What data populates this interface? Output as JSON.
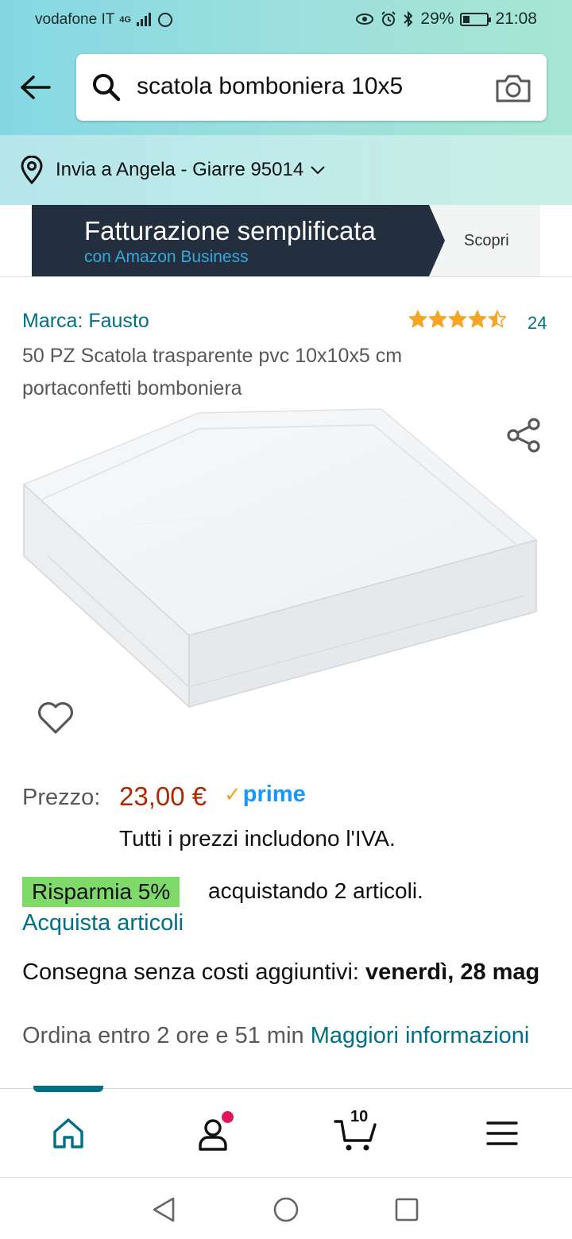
{
  "status_bar": {
    "carrier": "vodafone IT",
    "network": "4G",
    "battery": "29%",
    "battery_level": 0.29,
    "time": "21:08"
  },
  "search": {
    "query": "scatola bomboniera 10x5"
  },
  "location": {
    "text": "Invia a Angela - Giarre 95014"
  },
  "banner": {
    "title": "Fatturazione semplificata",
    "subtitle": "con Amazon Business",
    "cta": "Scopri"
  },
  "product": {
    "brand": "Marca: Fausto",
    "rating": 4.5,
    "rating_count": "24",
    "title": "50 PZ Scatola trasparente pvc 10x10x5 cm portaconfetti bomboniera"
  },
  "price": {
    "label": "Prezzo:",
    "value": "23,00 €",
    "prime": "prime",
    "vat_note": "Tutti i prezzi includono l'IVA."
  },
  "savings": {
    "badge": "Risparmia 5%",
    "text": "acquistando 2 articoli.",
    "link": "Acquista articoli"
  },
  "delivery": {
    "text": "Consegna senza costi aggiuntivi:",
    "date": "venerdì, 28 mag",
    "order_by": "Ordina entro 2 ore e 51 min",
    "more_info": "Maggiori informazioni"
  },
  "bottom_nav": {
    "cart_count": "10",
    "items": [
      "home-icon",
      "account-icon",
      "cart-icon",
      "menu-icon"
    ]
  },
  "colors": {
    "link": "#007185",
    "price": "#b12704",
    "savings_badge": "#7fda69",
    "star": "#f5a623",
    "banner": "#232f3e"
  }
}
